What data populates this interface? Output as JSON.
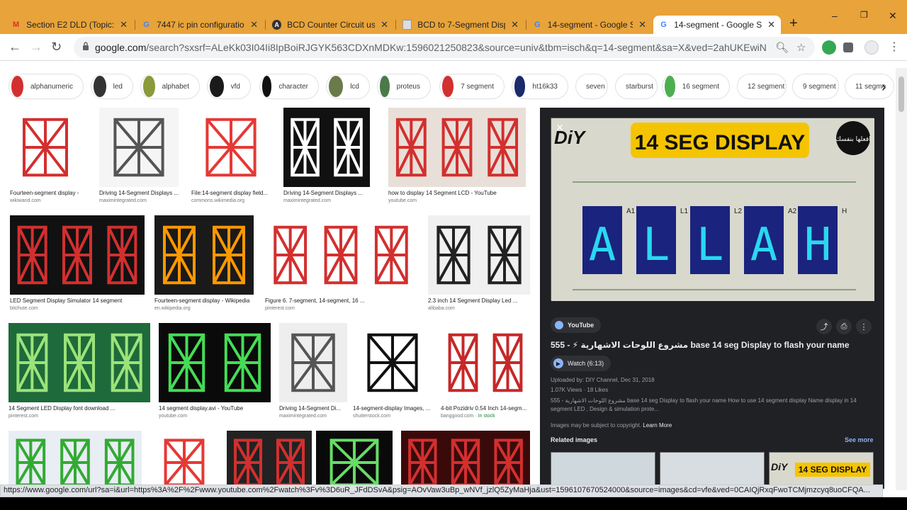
{
  "tabs": [
    {
      "title": "Section E2 DLD (Topic: ",
      "icon": "gmail-icon",
      "color": "#d93025"
    },
    {
      "title": "7447 ic pin configuration",
      "icon": "google-icon",
      "color": "#4285f4"
    },
    {
      "title": "BCD Counter Circuit usin",
      "icon": "circuit-icon",
      "color": "#333333"
    },
    {
      "title": "BCD to 7-Segment Disp",
      "icon": "page-icon",
      "color": "#888888"
    },
    {
      "title": "14-segment - Google Sea",
      "icon": "google-icon",
      "color": "#4285f4"
    },
    {
      "title": "14-segment - Google Se",
      "icon": "google-icon",
      "color": "#4285f4"
    }
  ],
  "window": {
    "minimize": "–",
    "restore": "❐",
    "close": "✕"
  },
  "toolbar": {
    "url_host": "google.com",
    "url_rest": "/search?sxsrf=ALeKk03I04Ii8IpBoiRJGYK563CDXnMDKw:1596021250823&source=univ&tbm=isch&q=14-segment&sa=X&ved=2ahUKEwiN-NW9qvL..."
  },
  "chips": [
    {
      "label": "alphanumeric",
      "thumb": "#d32f2f"
    },
    {
      "label": "led",
      "thumb": "#333333"
    },
    {
      "label": "alphabet",
      "thumb": "#8a9a3a"
    },
    {
      "label": "vfd",
      "thumb": "#1a1a1a"
    },
    {
      "label": "character",
      "thumb": "#111111"
    },
    {
      "label": "lcd",
      "thumb": "#6b7a4a"
    },
    {
      "label": "proteus",
      "thumb": "#4a7a4a"
    },
    {
      "label": "7 segment",
      "thumb": "#d32f2f"
    },
    {
      "label": "ht16k33",
      "thumb": "#1a2a6a"
    },
    {
      "label": "seven",
      "thumb": ""
    },
    {
      "label": "starburst",
      "thumb": ""
    },
    {
      "label": "16 segment",
      "thumb": "#4caf50"
    },
    {
      "label": "12 segment",
      "thumb": ""
    },
    {
      "label": "9 segment",
      "thumb": ""
    },
    {
      "label": "11 segme",
      "thumb": ""
    }
  ],
  "results": [
    {
      "caption": "Fourteen-segment display - ...",
      "source": "wikiwand.com",
      "bg": "#ffffff",
      "fg": "#d32f2f"
    },
    {
      "caption": "Driving 14-Segment Displays ...",
      "source": "maximintegrated.com",
      "bg": "#f5f5f5",
      "fg": "#555555"
    },
    {
      "caption": "File:14-segment display field...",
      "source": "commons.wikimedia.org",
      "bg": "#ffffff",
      "fg": "#e53935"
    },
    {
      "caption": "Driving 14-Segment Displays ...",
      "source": "maximintegrated.com",
      "bg": "#111111",
      "fg": "#ffffff"
    },
    {
      "caption": "how to display 14 Segment LCD - YouTube",
      "source": "youtube.com",
      "bg": "#e8e0d8",
      "fg": "#d32f2f"
    },
    {
      "caption": "LED Segment Display Simulator 14 segment",
      "source": "bitchute.com",
      "bg": "#111111",
      "fg": "#d32f2f"
    },
    {
      "caption": "Fourteen-segment display - Wikipedia",
      "source": "en.wikipedia.org",
      "bg": "#1a1a1a",
      "fg": "#ff9800"
    },
    {
      "caption": "Figure 6. 7-segment, 14-segment, 16 ...",
      "source": "pinterest.com",
      "bg": "#ffffff",
      "fg": "#d32f2f"
    },
    {
      "caption": "2.3 inch 14 Segment Display Led ...",
      "source": "alibaba.com",
      "bg": "#f0f0f0",
      "fg": "#222222"
    },
    {
      "caption": "14 Segment LED Display font download ...",
      "source": "pinterest.com",
      "bg": "#1e6a3a",
      "fg": "#9be37a"
    },
    {
      "caption": "14 segment display.avi - YouTube",
      "source": "youtube.com",
      "bg": "#0a0a0a",
      "fg": "#44dd55"
    },
    {
      "caption": "Driving 14-Segment Di...",
      "source": "maximintegrated.com",
      "bg": "#eeeeee",
      "fg": "#555555"
    },
    {
      "caption": "14-segment-display Images, ...",
      "source": "shutterstock.com",
      "bg": "#ffffff",
      "fg": "#111111"
    },
    {
      "caption": "4-bit Pozidriv 0.54 Inch 14-segm...",
      "source": "banggood.com",
      "source_extra": " · In stock",
      "bg": "#ffffff",
      "fg": "#c62828"
    },
    {
      "caption": "",
      "source": "",
      "bg": "#e8eef4",
      "fg": "#33aa33"
    },
    {
      "caption": "",
      "source": "",
      "bg": "#ffffff",
      "fg": "#e53935"
    },
    {
      "caption": "",
      "source": "",
      "bg": "#222222",
      "fg": "#d32f2f"
    },
    {
      "caption": "",
      "source": "",
      "bg": "#0a0a0a",
      "fg": "#66dd66"
    },
    {
      "caption": "",
      "source": "",
      "bg": "#3a0a0a",
      "fg": "#d32f2f"
    }
  ],
  "panel": {
    "image_title": "14 SEG DISPLAY",
    "image_diy": "DiY",
    "image_arabic": "افعلها بنفسك",
    "letters": [
      "A",
      "L",
      "L",
      "A",
      "H"
    ],
    "pin_labels": [
      "A1",
      "L1",
      "L2",
      "A2",
      "H"
    ],
    "source_label": "YouTube",
    "title": "555 - ⚡ مشروع اللوحات الاشهارية base 14 seg Display to flash your name",
    "watch_label": "Watch (6:13)",
    "uploaded": "Uploaded by: DIY Channel, Dec 31, 2018",
    "stats": "1.07K Views · 18 Likes",
    "description": "555 - مشروع اللوحات الاشهارية base 14 seg Display to flash your name How to use 14 segment display Name display in 14 segment LED , Design & simulation prote...",
    "copyright": "Images may be subject to copyright.",
    "learn_more": "Learn More",
    "related": "Related images",
    "see_more": "See more",
    "related_thumb_text": "14 SEG DISPLAY",
    "related_diy": "DiY"
  },
  "statusbar": {
    "text": "https://www.google.com/url?sa=i&url=https%3A%2F%2Fwww.youtube.com%2Fwatch%3Fv%3D6uR_JFdDSvA&psig=AOvVaw3uBp_wNVf_jzlQ5ZyMaHja&ust=1596107670524000&source=images&cd=vfe&ved=0CAIQjRxqFwoTCMjmzcyq8uoCFQA..."
  }
}
